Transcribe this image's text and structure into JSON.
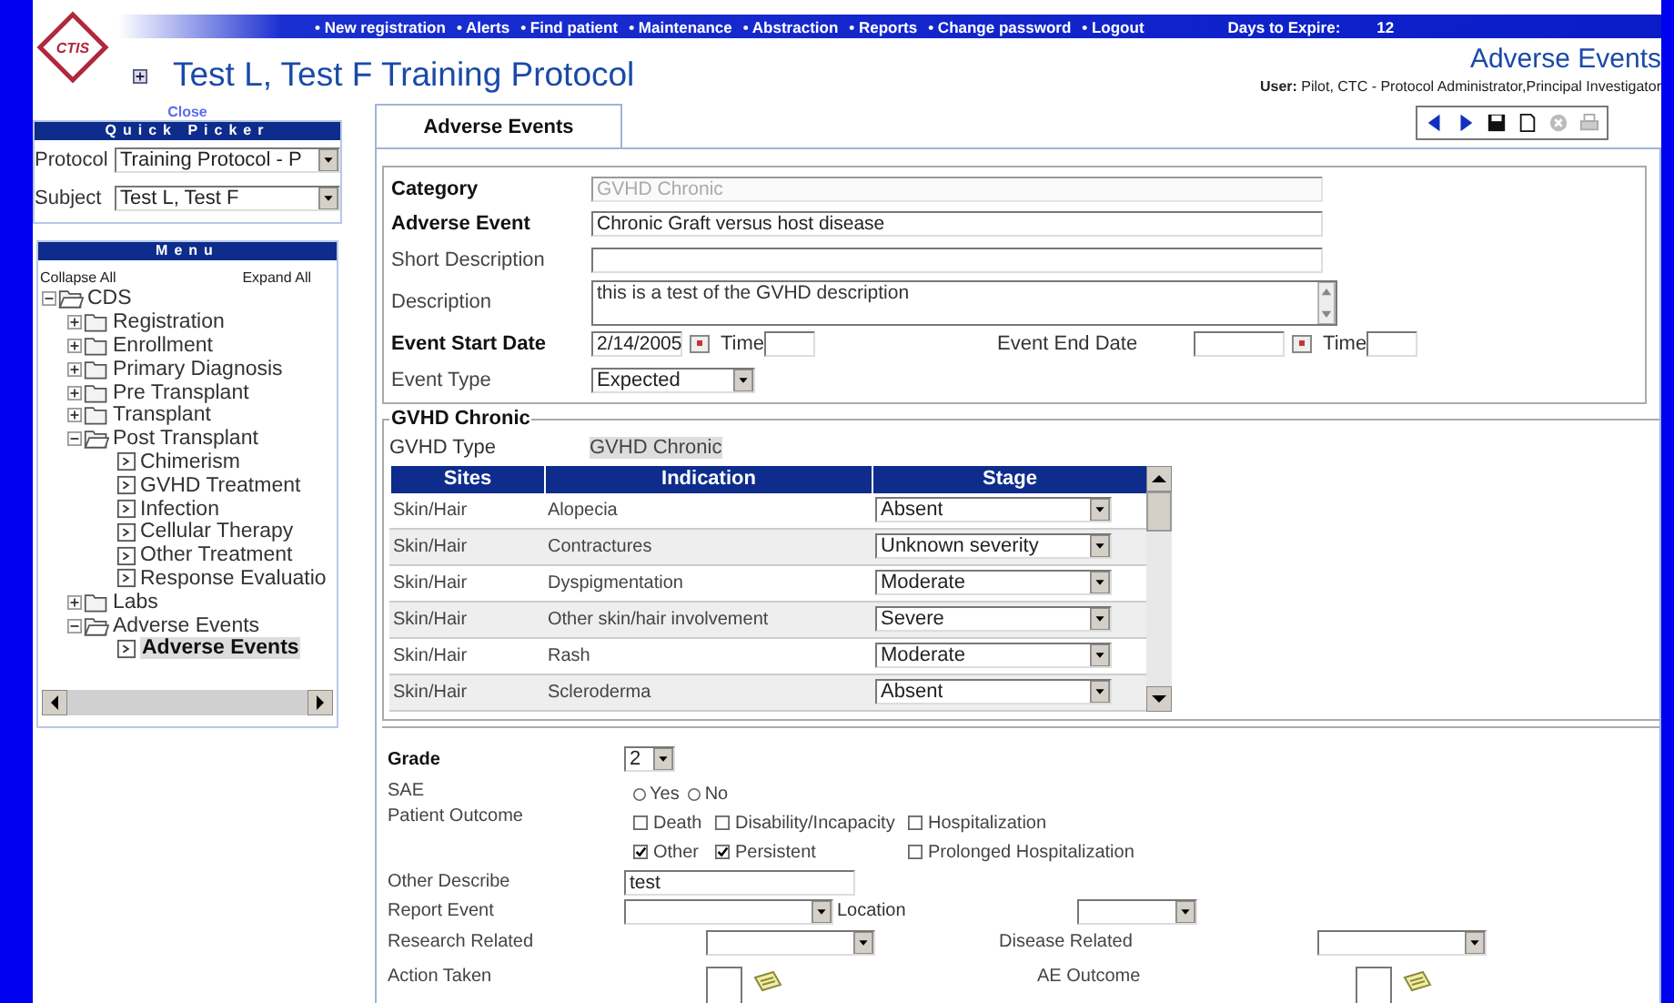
{
  "logo": {
    "text": "CTIS"
  },
  "nav": {
    "links": [
      "• New registration",
      "• Alerts",
      "• Find patient",
      "• Maintenance",
      "• Abstraction",
      "• Reports",
      "• Change password",
      "• Logout"
    ],
    "days_label": "Days to Expire:",
    "days_value": "12"
  },
  "header": {
    "title": "Test L, Test F Training Protocol",
    "page_title": "Adverse Events",
    "user_label": "User:",
    "user": "Pilot, CTC - Protocol Administrator,Principal Investigator"
  },
  "sidebar": {
    "close": "Close",
    "quick_picker": {
      "title": "Quick Picker",
      "fields": [
        {
          "label": "Protocol",
          "value": "Training Protocol - P"
        },
        {
          "label": "Subject",
          "value": "Test L, Test F"
        }
      ]
    },
    "menu": {
      "title": "Menu",
      "collapse_all": "Collapse All",
      "expand_all": "Expand All",
      "tree": [
        {
          "label": "CDS",
          "kind": "folder",
          "expanded": true,
          "selected": false,
          "children": [
            {
              "label": "Registration",
              "kind": "folder",
              "expanded": false,
              "selected": false
            },
            {
              "label": "Enrollment",
              "kind": "folder",
              "expanded": false,
              "selected": false
            },
            {
              "label": "Primary Diagnosis",
              "kind": "folder",
              "expanded": false,
              "selected": false
            },
            {
              "label": "Pre Transplant",
              "kind": "folder",
              "expanded": false,
              "selected": false
            },
            {
              "label": "Transplant",
              "kind": "folder",
              "expanded": false,
              "selected": false
            },
            {
              "label": "Post Transplant",
              "kind": "folder",
              "expanded": true,
              "selected": false,
              "children": [
                {
                  "label": "Chimerism",
                  "kind": "page",
                  "selected": false
                },
                {
                  "label": "GVHD Treatment",
                  "kind": "page",
                  "selected": false
                },
                {
                  "label": "Infection",
                  "kind": "page",
                  "selected": false
                },
                {
                  "label": "Cellular Therapy",
                  "kind": "page",
                  "selected": false
                },
                {
                  "label": "Other Treatment",
                  "kind": "page",
                  "selected": false
                },
                {
                  "label": "Response Evaluatio",
                  "kind": "page",
                  "selected": false
                }
              ]
            },
            {
              "label": "Labs",
              "kind": "folder",
              "expanded": false,
              "selected": false
            },
            {
              "label": "Adverse Events",
              "kind": "folder",
              "expanded": true,
              "selected": false,
              "children": [
                {
                  "label": "Adverse Events",
                  "kind": "page",
                  "selected": true
                }
              ]
            }
          ]
        }
      ]
    }
  },
  "tabs": [
    {
      "label": "Adverse Events",
      "selected": true
    }
  ],
  "event_rows": [
    {
      "kind": "text",
      "label": "Category",
      "required": true,
      "value": "GVHD Chronic",
      "disabled": true
    },
    {
      "kind": "text",
      "label": "Adverse Event",
      "required": true,
      "value": "Chronic Graft versus host disease",
      "disabled": false
    },
    {
      "kind": "text",
      "label": "Short Description",
      "required": false,
      "disabled": false
    },
    {
      "kind": "textarea",
      "label": "Description",
      "required": false,
      "value": "this is a test of the GVHD description"
    },
    {
      "kind": "dates",
      "label": "Event Start Date",
      "required": true,
      "value": "2/14/2005",
      "time_label": "Time",
      "end_label": "Event End Date",
      "end_time_label": "Time"
    },
    {
      "kind": "select",
      "label": "Event Type",
      "required": false,
      "value": "Expected"
    }
  ],
  "gvhd": {
    "legend": "GVHD Chronic",
    "type_label": "GVHD Type",
    "type_value": "GVHD Chronic",
    "table": {
      "columns": [
        "Sites",
        "Indication",
        "Stage"
      ],
      "rows": [
        {
          "site": "Skin/Hair",
          "indication": "Alopecia",
          "stage": "Absent"
        },
        {
          "site": "Skin/Hair",
          "indication": "Contractures",
          "stage": "Unknown severity"
        },
        {
          "site": "Skin/Hair",
          "indication": "Dyspigmentation",
          "stage": "Moderate"
        },
        {
          "site": "Skin/Hair",
          "indication": "Other skin/hair involvement",
          "stage": "Severe"
        },
        {
          "site": "Skin/Hair",
          "indication": "Rash",
          "stage": "Moderate"
        },
        {
          "site": "Skin/Hair",
          "indication": "Scleroderma",
          "stage": "Absent"
        }
      ]
    }
  },
  "outcome": {
    "grade": {
      "label": "Grade",
      "value": "2"
    },
    "sae": {
      "label": "SAE",
      "options": [
        {
          "label": "Yes",
          "selected": false
        },
        {
          "label": "No",
          "selected": false
        }
      ]
    },
    "patient_outcome": {
      "label": "Patient Outcome",
      "options": [
        {
          "label": "Death",
          "checked": false
        },
        {
          "label": "Disability/Incapacity",
          "checked": false
        },
        {
          "label": "Hospitalization",
          "checked": false
        },
        {
          "label": "Other",
          "checked": true
        },
        {
          "label": "Persistent",
          "checked": true
        },
        {
          "label": "Prolonged Hospitalization",
          "checked": false
        }
      ]
    },
    "other_describe": {
      "label": "Other Describe",
      "value": "test"
    },
    "report_event": {
      "label": "Report Event",
      "location_label": "Location"
    },
    "research_related": {
      "label": "Research Related"
    },
    "disease_related": {
      "label": "Disease Related"
    },
    "action_taken": {
      "label": "Action Taken"
    },
    "ae_outcome": {
      "label": "AE Outcome"
    }
  }
}
